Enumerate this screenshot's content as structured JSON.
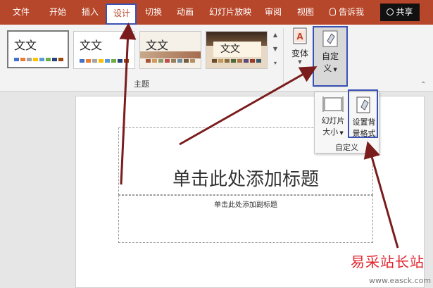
{
  "tabs": [
    {
      "label": "文件",
      "active": false
    },
    {
      "label": "开始",
      "active": false
    },
    {
      "label": "插入",
      "active": false
    },
    {
      "label": "设计",
      "active": true
    },
    {
      "label": "切换",
      "active": false
    },
    {
      "label": "动画",
      "active": false
    },
    {
      "label": "幻灯片放映",
      "active": false
    },
    {
      "label": "审阅",
      "active": false
    },
    {
      "label": "视图",
      "active": false
    }
  ],
  "tell_me": "告诉我",
  "share": "共享",
  "themes": {
    "items": [
      {
        "label": "文文"
      },
      {
        "label": "文文"
      },
      {
        "label": "文文"
      },
      {
        "label": "文文"
      }
    ],
    "group_label": "主题"
  },
  "variants": {
    "label": "变体"
  },
  "customize": {
    "label_line1": "自定",
    "label_line2": "义"
  },
  "dropdown": {
    "slide_size_line1": "幻灯片",
    "slide_size_line2": "大小",
    "format_bg_line1": "设置背",
    "format_bg_line2": "景格式",
    "group_label": "自定义"
  },
  "slide": {
    "title_placeholder": "单击此处添加标题",
    "subtitle_placeholder": "单击此处添加副标题"
  },
  "watermark": {
    "text": "易采站长站",
    "url": "www.easck.com"
  },
  "colors": {
    "ribbon_accent": "#b7472a",
    "highlight_box": "#3a52b5",
    "arrow": "#7a1c1c",
    "watermark": "#e0242e"
  }
}
